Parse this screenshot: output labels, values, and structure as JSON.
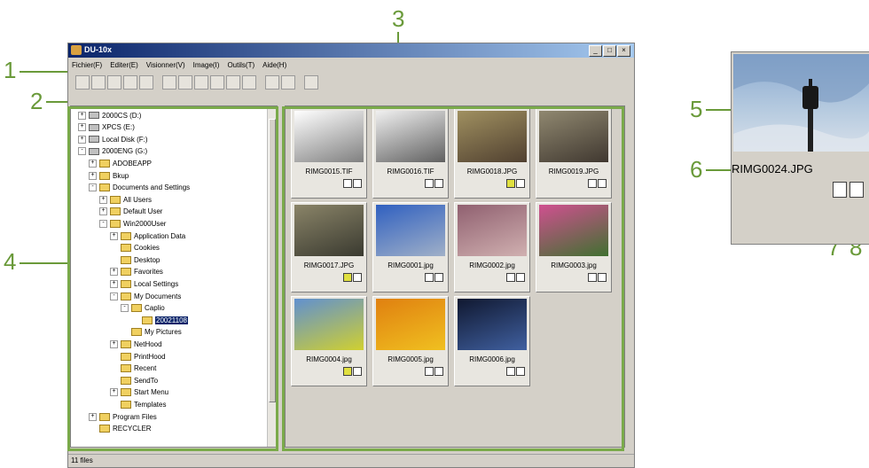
{
  "callouts": [
    "1",
    "2",
    "3",
    "4",
    "5",
    "6",
    "7",
    "8"
  ],
  "window": {
    "title": "DU-10x",
    "buttons": [
      "_",
      "□",
      "×"
    ],
    "menu": [
      "Fichier(F)",
      "Editer(E)",
      "Visionner(V)",
      "Image(I)",
      "Outils(T)",
      "Aide(H)"
    ],
    "status": "11 files"
  },
  "tree": [
    {
      "label": "2000CS (D:)",
      "depth": 1,
      "type": "drive",
      "pm": "+"
    },
    {
      "label": "XPCS (E:)",
      "depth": 1,
      "type": "drive",
      "pm": "+"
    },
    {
      "label": "Local Disk (F:)",
      "depth": 1,
      "type": "drive",
      "pm": "+"
    },
    {
      "label": "2000ENG (G:)",
      "depth": 1,
      "type": "drive",
      "pm": "-"
    },
    {
      "label": "ADOBEAPP",
      "depth": 2,
      "type": "folder",
      "pm": "+"
    },
    {
      "label": "Bkup",
      "depth": 2,
      "type": "folder",
      "pm": "+"
    },
    {
      "label": "Documents and Settings",
      "depth": 2,
      "type": "folder",
      "pm": "-"
    },
    {
      "label": "All Users",
      "depth": 3,
      "type": "folder",
      "pm": "+"
    },
    {
      "label": "Default User",
      "depth": 3,
      "type": "folder",
      "pm": "+"
    },
    {
      "label": "Win2000User",
      "depth": 3,
      "type": "folder",
      "pm": "-"
    },
    {
      "label": "Application Data",
      "depth": 4,
      "type": "folder",
      "pm": "+"
    },
    {
      "label": "Cookies",
      "depth": 4,
      "type": "folder",
      "pm": ""
    },
    {
      "label": "Desktop",
      "depth": 4,
      "type": "folder",
      "pm": ""
    },
    {
      "label": "Favorites",
      "depth": 4,
      "type": "folder",
      "pm": "+"
    },
    {
      "label": "Local Settings",
      "depth": 4,
      "type": "folder",
      "pm": "+"
    },
    {
      "label": "My Documents",
      "depth": 4,
      "type": "folder",
      "pm": "-"
    },
    {
      "label": "Caplio",
      "depth": 5,
      "type": "folder",
      "pm": "-"
    },
    {
      "label": "20021108",
      "depth": 6,
      "type": "folder",
      "pm": "",
      "selected": true
    },
    {
      "label": "My Pictures",
      "depth": 5,
      "type": "folder",
      "pm": ""
    },
    {
      "label": "NetHood",
      "depth": 4,
      "type": "folder",
      "pm": "+"
    },
    {
      "label": "PrintHood",
      "depth": 4,
      "type": "folder",
      "pm": ""
    },
    {
      "label": "Recent",
      "depth": 4,
      "type": "folder",
      "pm": ""
    },
    {
      "label": "SendTo",
      "depth": 4,
      "type": "folder",
      "pm": ""
    },
    {
      "label": "Start Menu",
      "depth": 4,
      "type": "folder",
      "pm": "+"
    },
    {
      "label": "Templates",
      "depth": 4,
      "type": "folder",
      "pm": ""
    },
    {
      "label": "Program Files",
      "depth": 2,
      "type": "folder",
      "pm": "+"
    },
    {
      "label": "RECYCLER",
      "depth": 2,
      "type": "folder",
      "pm": ""
    }
  ],
  "thumbnails": [
    {
      "name": "RIMG0015.TIF",
      "colors": [
        "#ffffff",
        "#808080"
      ],
      "audio": false
    },
    {
      "name": "RIMG0016.TIF",
      "colors": [
        "#f0f0f0",
        "#606060"
      ],
      "audio": false
    },
    {
      "name": "RIMG0018.JPG",
      "colors": [
        "#a09060",
        "#504030"
      ],
      "audio": true
    },
    {
      "name": "RIMG0019.JPG",
      "colors": [
        "#908870",
        "#403830"
      ],
      "audio": false
    },
    {
      "name": "RIMG0017.JPG",
      "colors": [
        "#8a8468",
        "#3a3a30"
      ],
      "audio": true
    },
    {
      "name": "RIMG0001.jpg",
      "colors": [
        "#3060c0",
        "#a0b0c8"
      ],
      "audio": false
    },
    {
      "name": "RIMG0002.jpg",
      "colors": [
        "#906070",
        "#d0b0b0"
      ],
      "audio": false
    },
    {
      "name": "RIMG0003.jpg",
      "colors": [
        "#d05090",
        "#407030"
      ],
      "audio": false
    },
    {
      "name": "RIMG0004.jpg",
      "colors": [
        "#6090d0",
        "#d0d030"
      ],
      "audio": true
    },
    {
      "name": "RIMG0005.jpg",
      "colors": [
        "#e08010",
        "#f0c020"
      ],
      "audio": false
    },
    {
      "name": "RIMG0006.jpg",
      "colors": [
        "#101830",
        "#4060a0"
      ],
      "audio": false
    }
  ],
  "detail": {
    "name": "RIMG0024.JPG"
  },
  "accent": "#7aaa4a"
}
